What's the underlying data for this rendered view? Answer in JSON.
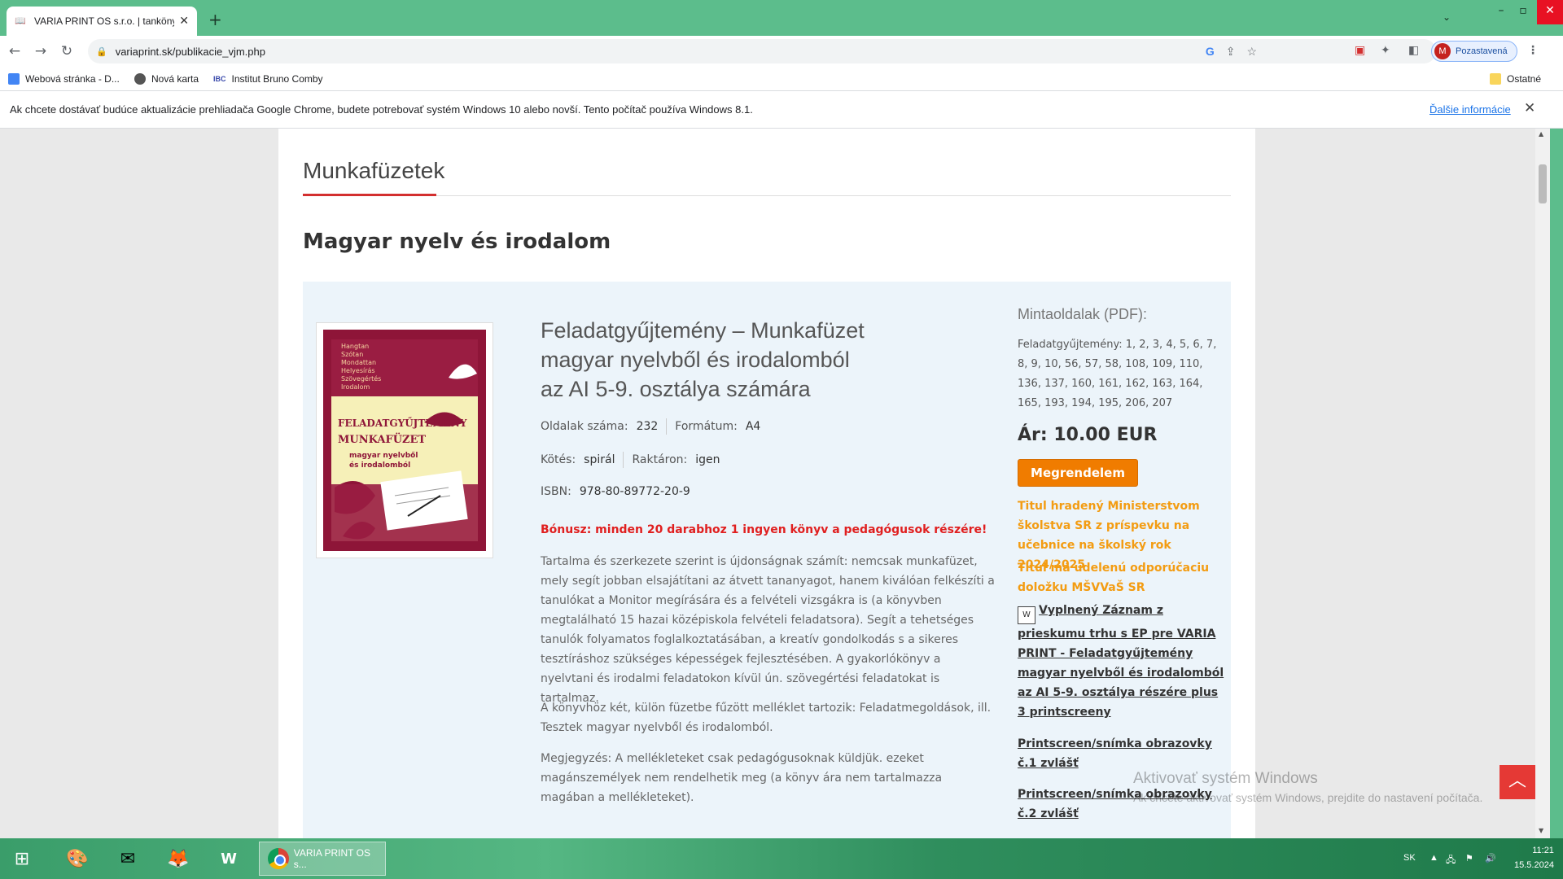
{
  "browser": {
    "tab_title": "VARIA PRINT OS s.r.o. | tankönyvk",
    "url": "variaprint.sk/publikacie_vjm.php",
    "profile_label": "Pozastavená",
    "profile_initial": "M",
    "bookmarks": [
      {
        "label": "Webová stránka - D...",
        "icon": "docs-icon"
      },
      {
        "label": "Nová karta",
        "icon": "globe-icon"
      },
      {
        "label": "Institut Bruno Comby",
        "icon": "ibc-icon"
      }
    ],
    "other_bookmarks": "Ostatné",
    "infobar_message": "Ak chcete dostávať budúce aktualizácie prehliadača Google Chrome, budete potrebovať systém Windows 10 alebo novší. Tento počítač používa Windows 8.1.",
    "infobar_link": "Ďalšie informácie"
  },
  "page": {
    "section_title": "Munkafüzetek",
    "subject_title": "Magyar nyelv és irodalom",
    "product": {
      "title_lines": [
        "Feladatgyűjtemény – Munkafüzet",
        "magyar nyelvből és irodalomból",
        "az AI 5-9. osztálya számára"
      ],
      "pages_label": "Oldalak száma:",
      "pages_value": "232",
      "format_label": "Formátum:",
      "format_value": "A4",
      "binding_label": "Kötés:",
      "binding_value": "spirál",
      "stock_label": "Raktáron:",
      "stock_value": "igen",
      "isbn_label": "ISBN:",
      "isbn_value": "978-80-89772-20-9",
      "bonus": "Bónusz: minden 20 darabhoz 1 ingyen könyv a pedagógusok részére!",
      "description": "Tartalma és szerkezete szerint is újdonságnak számít: nemcsak munkafüzet, mely segít jobban elsajátítani az átvett tananyagot, hanem kiválóan felkészíti a tanulókat a Monitor megírására és a felvételi vizsgákra is (a könyvben megtalálható 15 hazai középiskola felvételi feladatsora). Segít a tehetséges tanulók folyamatos foglalkoztatásában, a kreatív gondolkodás s a sikeres tesztíráshoz szükséges képességek fejlesztésében. A gyakorlókönyv a nyelvtani és irodalmi feladatokon kívül ún. szövegértési feladatokat is tartalmaz.",
      "attachments": "A könyvhöz két, külön füzetbe fűzött melléklet tartozik: Feladatmegoldások, ill. Tesztek magyar nyelvből és irodalomból.",
      "note": "Megjegyzés: A mellékleteket csak pedagógusoknak küldjük. ezeket magánszemélyek nem rendelhetik meg (a könyv ára nem tartalmazza magában a mellékleteket).",
      "cover_lines": [
        "Hangtan",
        "Szótan",
        "Mondattan",
        "Helyesírás",
        "Szövegértés",
        "Irodalom"
      ],
      "cover_title_1": "Feladatgyűjtemény",
      "cover_title_2": "Munkafüzet",
      "cover_subtitle_1": "magyar nyelvből",
      "cover_subtitle_2": "és irodalomból"
    },
    "sidebar": {
      "samples_title": "Mintaoldalak (PDF):",
      "samples_text": "Feladatgyűjtemény: 1, 2, 3, 4, 5, 6, 7, 8, 9, 10, 56, 57, 58, 108, 109, 110, 136, 137, 160, 161, 162, 163, 164, 165, 193, 194, 195, 206, 207",
      "price": "Ár: 10.00 EUR",
      "order_button": "Megrendelem",
      "funded_text": "Titul hradený Ministerstvom školstva SR z príspevku na učebnice na školský rok 2024/2025",
      "recommended_text": "Titul má udelenú odporúčaciu doložku MŠVVaŠ SR",
      "record_link": "Vyplnený Záznam z prieskumu trhu s EP pre VARIA PRINT - Feladatgyűjtemény magyar nyelvből és irodalomból az AI 5-9. osztálya részére plus 3 printscreeny",
      "printscreen_1": "Printscreen/snímka obrazovky č.1 zvlášť",
      "printscreen_2": "Printscreen/snímka obrazovky č.2 zvlášť"
    },
    "watermark_title": "Aktivovať systém Windows",
    "watermark_text": "Ak chcete aktivovať systém Windows, prejdite do nastavení počítača."
  },
  "taskbar": {
    "active_window_label": "VARIA PRINT OS s...",
    "language": "SK",
    "time": "11:21",
    "date": "15.5.2024"
  },
  "colors": {
    "accent_red": "#d32f2f",
    "bonus_red": "#e01f1f",
    "orange": "#f39c12",
    "order_button": "#f07c00",
    "card_bg": "#ecf4fa",
    "titlebar_green": "#5cbd8c"
  }
}
